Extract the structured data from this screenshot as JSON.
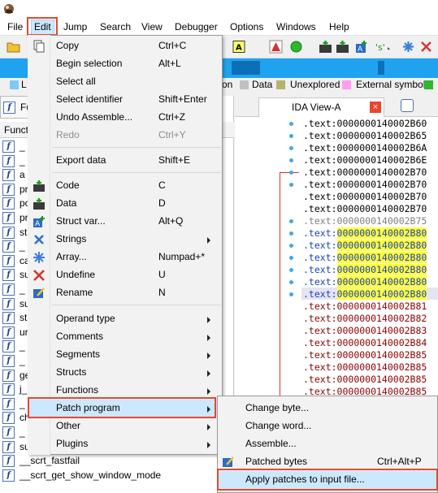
{
  "colors": {
    "accent": "#e8472b",
    "highlight_bg": "#cce8ff",
    "nav_band": "#1fa3f0",
    "address_highlight": "#ffff3c"
  },
  "menubar": {
    "items": [
      {
        "label": "File"
      },
      {
        "label": "Edit"
      },
      {
        "label": "Jump"
      },
      {
        "label": "Search"
      },
      {
        "label": "View"
      },
      {
        "label": "Debugger"
      },
      {
        "label": "Options"
      },
      {
        "label": "Windows"
      },
      {
        "label": "Help"
      }
    ]
  },
  "legend": {
    "items": [
      {
        "label": "L",
        "color": "#7ec8f7"
      },
      {
        "label": "on",
        "color": ""
      },
      {
        "label": "Data",
        "color": "#c0c0c0"
      },
      {
        "label": "Unexplored",
        "color": "#b5b36c"
      },
      {
        "label": "External symbol",
        "color": "#ff9cf0"
      },
      {
        "label": "",
        "color": "#2db82d"
      }
    ]
  },
  "functions_panel": {
    "tab_label": "Fu",
    "header": "Functi",
    "visible_names": [
      {
        "name": "_"
      },
      {
        "name": "_"
      },
      {
        "name": "a"
      },
      {
        "name": "pr"
      },
      {
        "name": "pc"
      },
      {
        "name": "pr"
      },
      {
        "name": "st"
      },
      {
        "name": "_"
      },
      {
        "name": "ca"
      },
      {
        "name": "sul"
      },
      {
        "name": "_"
      },
      {
        "name": "su"
      },
      {
        "name": "st"
      },
      {
        "name": "ur"
      },
      {
        "name": "_"
      },
      {
        "name": "_"
      },
      {
        "name": "ge"
      },
      {
        "name": "j_"
      },
      {
        "name": "_"
      },
      {
        "name": "ch"
      },
      {
        "name": "_"
      },
      {
        "name": "sub_140003ED8"
      },
      {
        "name": "__scrt_fastfail"
      },
      {
        "name": "__scrt_get_show_window_mode"
      }
    ]
  },
  "ida_view": {
    "tab_label": "IDA View-A",
    "lines": [
      {
        "prefix": ".text:",
        "addr": "0000000140002B60"
      },
      {
        "prefix": ".text:",
        "addr": "0000000140002B65"
      },
      {
        "prefix": ".text:",
        "addr": "0000000140002B6A"
      },
      {
        "prefix": ".text:",
        "addr": "0000000140002B6E"
      },
      {
        "prefix": ".text:",
        "addr": "0000000140002B70"
      },
      {
        "prefix": ".text:",
        "addr": "0000000140002B70"
      },
      {
        "prefix": ".text:",
        "addr": "0000000140002B70"
      },
      {
        "prefix": ".text:",
        "addr": "0000000140002B70"
      },
      {
        "prefix": ".text:",
        "addr": "0000000140002B75"
      },
      {
        "prefix": ".text:",
        "addr": "0000000140002B80"
      },
      {
        "prefix": ".text:",
        "addr": "0000000140002B80"
      },
      {
        "prefix": ".text:",
        "addr": "0000000140002B80"
      },
      {
        "prefix": ".text:",
        "addr": "0000000140002B80"
      },
      {
        "prefix": ".text:",
        "addr": "0000000140002B80"
      },
      {
        "prefix": ".text:",
        "addr": "0000000140002B80"
      },
      {
        "prefix": ".text:",
        "addr": "0000000140002B81"
      },
      {
        "prefix": ".text:",
        "addr": "0000000140002B82"
      },
      {
        "prefix": ".text:",
        "addr": "0000000140002B83"
      },
      {
        "prefix": ".text:",
        "addr": "0000000140002B84"
      },
      {
        "prefix": ".text:",
        "addr": "0000000140002B85"
      },
      {
        "prefix": ".text:",
        "addr": "0000000140002B85"
      },
      {
        "prefix": ".text:",
        "addr": "0000000140002B85"
      },
      {
        "prefix": ".text:",
        "addr": "0000000140002B85"
      },
      {
        "prefix": ".text:",
        "addr": "0000000140002B85"
      }
    ]
  },
  "edit_menu": {
    "items": [
      {
        "label": "Copy",
        "shortcut": "Ctrl+C",
        "icon": "copy-icon"
      },
      {
        "label": "Begin selection",
        "shortcut": "Alt+L"
      },
      {
        "label": "Select all",
        "shortcut": ""
      },
      {
        "label": "Select identifier",
        "shortcut": "Shift+Enter"
      },
      {
        "label": "Undo Assemble...",
        "shortcut": "Ctrl+Z"
      },
      {
        "label": "Redo",
        "shortcut": "Ctrl+Y"
      },
      {
        "label": "Export data",
        "shortcut": "Shift+E"
      },
      {
        "label": "Code",
        "shortcut": "C",
        "icon": "code-icon"
      },
      {
        "label": "Data",
        "shortcut": "D",
        "icon": "data-icon"
      },
      {
        "label": "Struct var...",
        "shortcut": "Alt+Q",
        "icon": "struct-var-icon"
      },
      {
        "label": "Strings",
        "shortcut": "",
        "icon": "strings-icon"
      },
      {
        "label": "Array...",
        "shortcut": "Numpad+*",
        "icon": "array-icon"
      },
      {
        "label": "Undefine",
        "shortcut": "U",
        "icon": "undefine-icon"
      },
      {
        "label": "Rename",
        "shortcut": "N",
        "icon": "rename-icon"
      },
      {
        "label": "Operand type",
        "shortcut": ""
      },
      {
        "label": "Comments",
        "shortcut": ""
      },
      {
        "label": "Segments",
        "shortcut": ""
      },
      {
        "label": "Structs",
        "shortcut": ""
      },
      {
        "label": "Functions",
        "shortcut": ""
      },
      {
        "label": "Patch program",
        "shortcut": ""
      },
      {
        "label": "Other",
        "shortcut": ""
      },
      {
        "label": "Plugins",
        "shortcut": ""
      }
    ]
  },
  "patch_submenu": {
    "items": [
      {
        "label": "Change byte...",
        "shortcut": ""
      },
      {
        "label": "Change word...",
        "shortcut": ""
      },
      {
        "label": "Assemble...",
        "shortcut": ""
      },
      {
        "label": "Patched bytes",
        "shortcut": "Ctrl+Alt+P",
        "icon": "patched-bytes-icon"
      },
      {
        "label": "Apply patches to input file...",
        "shortcut": ""
      }
    ]
  }
}
